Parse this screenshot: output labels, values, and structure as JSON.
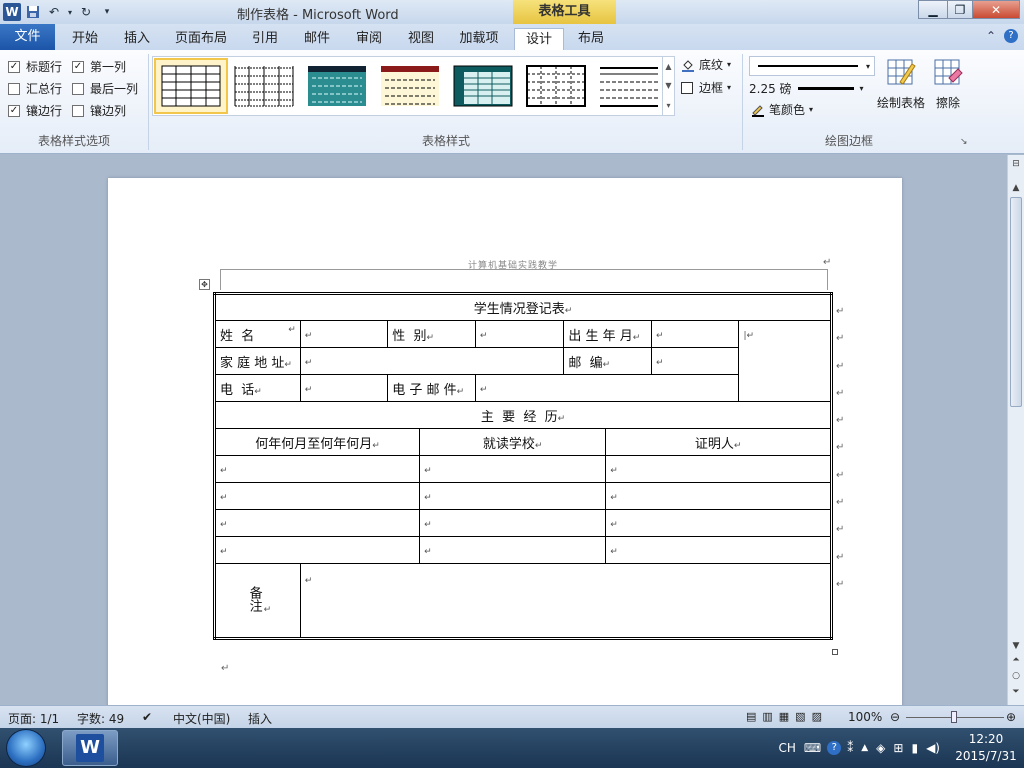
{
  "window": {
    "title": "制作表格 - Microsoft Word",
    "contextual_tab": "表格工具",
    "quick_access": [
      "save-icon",
      "undo-icon",
      "redo-icon",
      "customize-icon"
    ]
  },
  "ribbon": {
    "tabs": [
      {
        "label": "文件"
      },
      {
        "label": "开始"
      },
      {
        "label": "插入"
      },
      {
        "label": "页面布局"
      },
      {
        "label": "引用"
      },
      {
        "label": "邮件"
      },
      {
        "label": "审阅"
      },
      {
        "label": "视图"
      },
      {
        "label": "加载项"
      },
      {
        "label": "设计"
      },
      {
        "label": "布局"
      }
    ],
    "active_tab": "设计",
    "style_options": {
      "group_label": "表格样式选项",
      "items": [
        {
          "label": "标题行",
          "checked": true
        },
        {
          "label": "第一列",
          "checked": true
        },
        {
          "label": "汇总行",
          "checked": false
        },
        {
          "label": "最后一列",
          "checked": false
        },
        {
          "label": "镶边行",
          "checked": true
        },
        {
          "label": "镶边列",
          "checked": false
        }
      ]
    },
    "table_styles": {
      "group_label": "表格样式",
      "shading_label": "底纹",
      "borders_label": "边框"
    },
    "draw_borders": {
      "group_label": "绘图边框",
      "weight": "2.25 磅",
      "pen_color_label": "笔颜色",
      "draw_table_label": "绘制表格",
      "eraser_label": "擦除"
    }
  },
  "document": {
    "header": "计算机基础实践教学",
    "table": {
      "title": "学生情况登记表",
      "row1": [
        "姓  名",
        "性  别",
        "出 生 年 月"
      ],
      "row2": [
        "家 庭 地 址",
        "邮  编"
      ],
      "row3": [
        "电  话",
        "电 子 邮 件"
      ],
      "section": "主  要  经  历",
      "history_headers": [
        "何年何月至何年何月",
        "就读学校",
        "证明人"
      ],
      "history_rows": 4,
      "remark": "备注"
    }
  },
  "status": {
    "page": "页面: 1/1",
    "words": "字数: 49",
    "language": "中文(中国)",
    "mode": "插入",
    "zoom": "100%"
  },
  "taskbar": {
    "ime": "CH",
    "time": "12:20",
    "date": "2015/7/31"
  }
}
